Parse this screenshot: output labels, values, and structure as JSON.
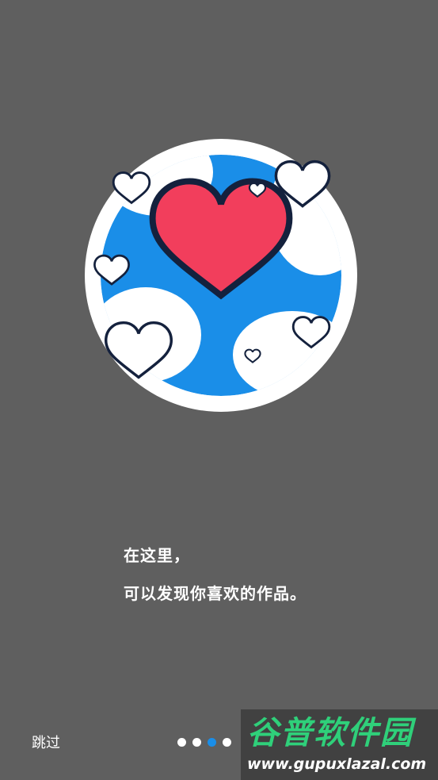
{
  "onboarding": {
    "headline": "在这里，",
    "subline": "可以发现你喜欢的作品。"
  },
  "footer": {
    "skip_label": "跳过",
    "pager": {
      "count": 4,
      "active_index": 2
    }
  },
  "watermark": {
    "title": "谷普软件园",
    "url": "www.gupuxlazal.com"
  },
  "colors": {
    "background": "#5f5f5f",
    "accent": "#1a8ee8",
    "heart": "#f23e5c",
    "outline": "#14213d"
  }
}
